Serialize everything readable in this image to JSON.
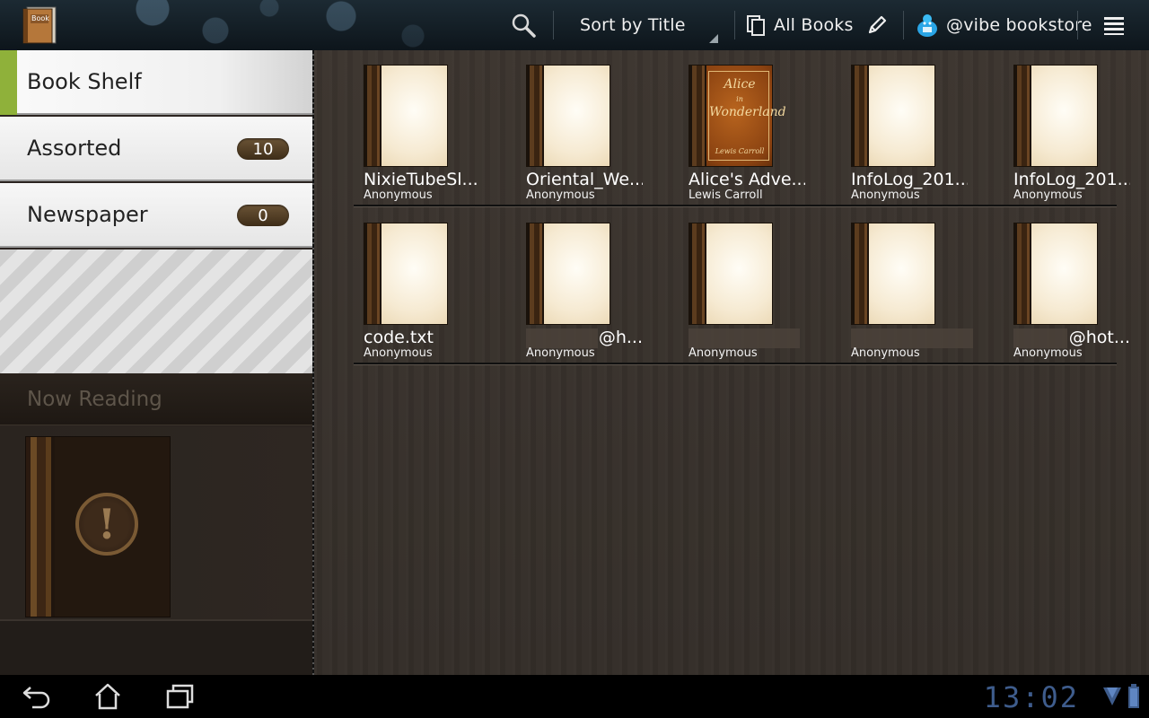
{
  "app": {
    "name": "Book"
  },
  "actionbar": {
    "sort_label": "Sort by Title",
    "filter_label": "All Books",
    "store_label": "@vibe bookstore"
  },
  "sidebar": {
    "items": [
      {
        "label": "Book Shelf",
        "count": ""
      },
      {
        "label": "Assorted",
        "count": "10"
      },
      {
        "label": "Newspaper",
        "count": "0"
      }
    ],
    "now_reading_label": "Now Reading"
  },
  "books": [
    {
      "title": "NixieTubeSl...",
      "author": "Anonymous",
      "cover": "blank"
    },
    {
      "title": "Oriental_We...",
      "author": "Anonymous",
      "cover": "blank"
    },
    {
      "title": "Alice's Adve...",
      "author": "Lewis Carroll",
      "cover": "alice",
      "cover_title": "Alice in Wonderland",
      "cover_author": "Lewis Carroll"
    },
    {
      "title": "InfoLog_201...",
      "author": "Anonymous",
      "cover": "blank"
    },
    {
      "title": "InfoLog_201...",
      "author": "Anonymous",
      "cover": "blank"
    },
    {
      "title": "code.txt",
      "author": "Anonymous",
      "cover": "blank"
    },
    {
      "title": "@h...",
      "author": "Anonymous",
      "cover": "blank"
    },
    {
      "title": "",
      "author": "Anonymous",
      "cover": "blank"
    },
    {
      "title": "",
      "author": "Anonymous",
      "cover": "blank"
    },
    {
      "title": "@hot...",
      "author": "Anonymous",
      "cover": "blank"
    }
  ],
  "system": {
    "clock": "13:02"
  },
  "colors": {
    "accent_green": "#8fb13a",
    "badge_brown": "#5a4328",
    "clock_blue": "#3e5c8c"
  }
}
